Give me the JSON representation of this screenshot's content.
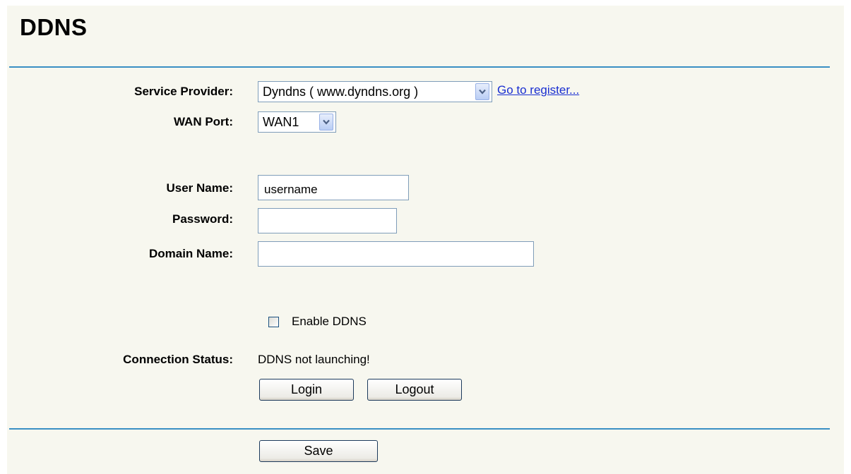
{
  "page": {
    "title": "DDNS"
  },
  "service_provider": {
    "label": "Service Provider:",
    "selected": "Dyndns ( www.dyndns.org )",
    "register_link": "Go to register..."
  },
  "wan_port": {
    "label": "WAN Port:",
    "selected": "WAN1"
  },
  "user_name": {
    "label": "User Name:",
    "value": "username"
  },
  "password": {
    "label": "Password:",
    "value": ""
  },
  "domain_name": {
    "label": "Domain Name:",
    "value": ""
  },
  "enable_ddns": {
    "label": "Enable DDNS",
    "checked": false
  },
  "connection_status": {
    "label": "Connection Status:",
    "value": "DDNS not launching!"
  },
  "buttons": {
    "login": "Login",
    "logout": "Logout",
    "save": "Save"
  },
  "colors": {
    "panel_bg": "#f7f7ef",
    "rule": "#3a8fc4",
    "link": "#1a2fd1"
  }
}
